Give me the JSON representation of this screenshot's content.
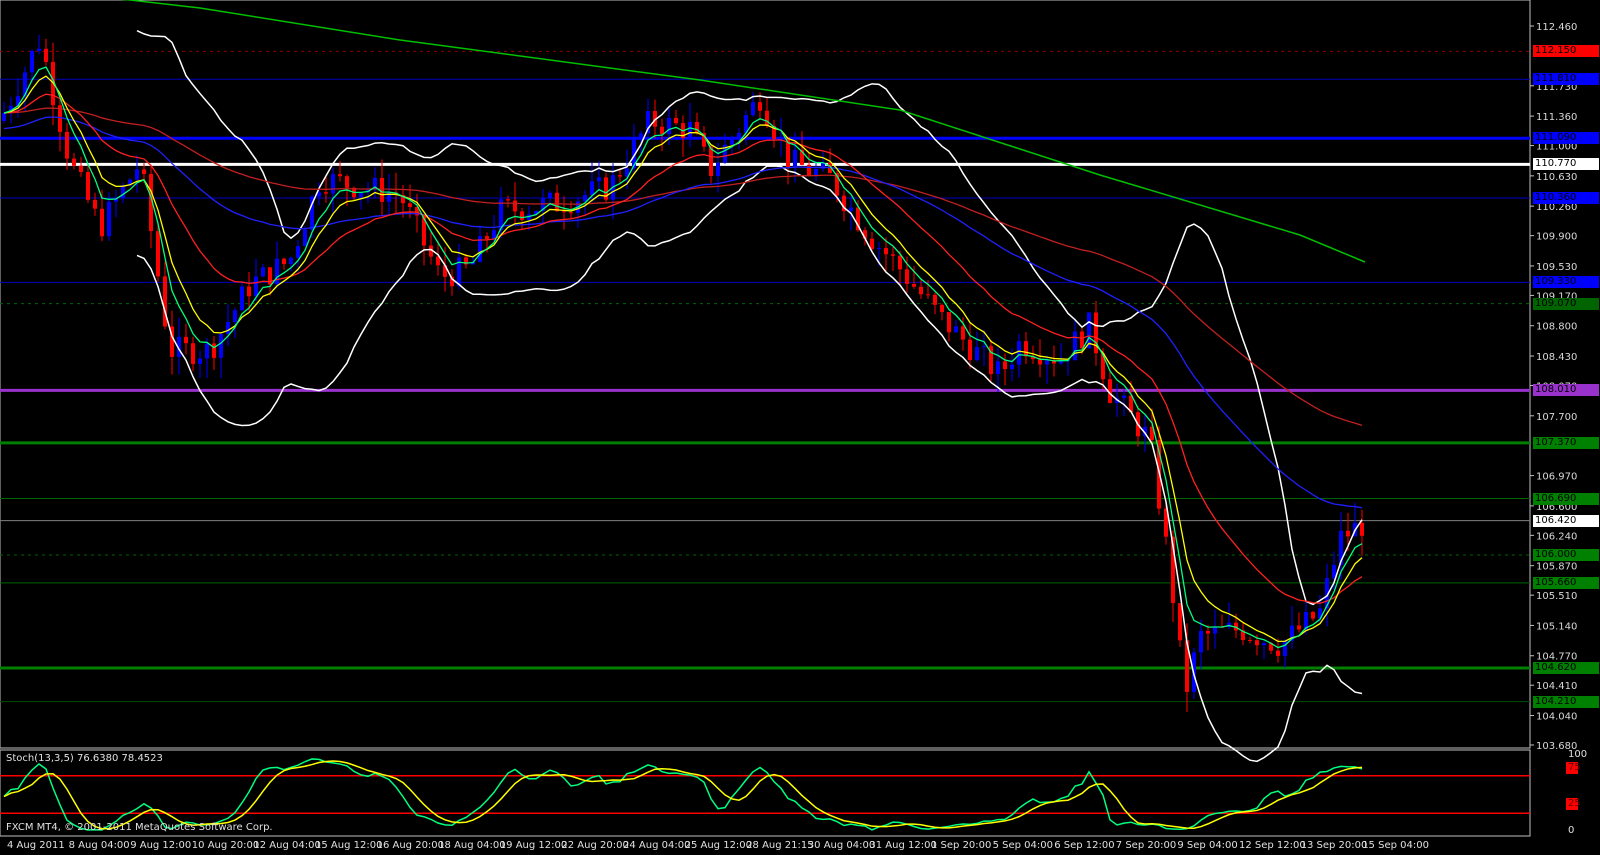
{
  "chart": {
    "symbol_pair": "USDJPY-like",
    "price_ticks": [
      "112.460",
      "111.730",
      "111.360",
      "111.000",
      "110.630",
      "110.260",
      "109.900",
      "109.530",
      "109.170",
      "108.800",
      "108.430",
      "108.070",
      "107.700",
      "106.970",
      "106.600",
      "106.240",
      "105.870",
      "105.510",
      "105.140",
      "104.770",
      "104.410",
      "104.040",
      "103.680"
    ],
    "price_range": [
      103.68,
      112.46
    ],
    "levels": [
      {
        "price": 112.15,
        "label": "112.150",
        "color": "#ff0000",
        "line": "#8b0000",
        "style": "dotted"
      },
      {
        "price": 111.81,
        "label": "111.810",
        "color": "#0000ff",
        "line": "#0000c0",
        "style": "thin"
      },
      {
        "price": 111.09,
        "label": "111.090",
        "color": "#0000ff",
        "line": "#0000ff",
        "style": "thick"
      },
      {
        "price": 110.77,
        "label": "110.770",
        "color": "#ffffff",
        "line": "#ffffff",
        "style": "thick"
      },
      {
        "price": 110.36,
        "label": "110.360",
        "color": "#0000ff",
        "line": "#0000c0",
        "style": "thin"
      },
      {
        "price": 109.33,
        "label": "109.330",
        "color": "#0000ff",
        "line": "#0000c0",
        "style": "thin"
      },
      {
        "price": 109.07,
        "label": "109.070",
        "color": "#006400",
        "line": "#006400",
        "style": "dotted"
      },
      {
        "price": 108.01,
        "label": "108.010",
        "color": "#9932cc",
        "line": "#9932cc",
        "style": "thick"
      },
      {
        "price": 107.37,
        "label": "107.370",
        "color": "#008000",
        "line": "#008000",
        "style": "thick"
      },
      {
        "price": 106.69,
        "label": "106.690",
        "color": "#008000",
        "line": "#006400",
        "style": "thin"
      },
      {
        "price": 106.42,
        "label": "106.420",
        "color": "#ffffff",
        "line": "#808080",
        "style": "thin"
      },
      {
        "price": 106.0,
        "label": "106.000",
        "color": "#008000",
        "line": "#006400",
        "style": "dotted"
      },
      {
        "price": 105.66,
        "label": "105.660",
        "color": "#008000",
        "line": "#006400",
        "style": "thin"
      },
      {
        "price": 104.62,
        "label": "104.620",
        "color": "#008000",
        "line": "#008000",
        "style": "thick"
      },
      {
        "price": 104.21,
        "label": "104.210",
        "color": "#008000",
        "line": "#004d00",
        "style": "thin"
      }
    ],
    "price_path": [
      [
        0,
        111.3
      ],
      [
        40,
        112.3
      ],
      [
        70,
        110.8
      ],
      [
        100,
        110.0
      ],
      [
        140,
        110.8
      ],
      [
        170,
        108.5
      ],
      [
        210,
        108.5
      ],
      [
        250,
        109.3
      ],
      [
        290,
        109.6
      ],
      [
        320,
        110.6
      ],
      [
        360,
        110.5
      ],
      [
        400,
        110.4
      ],
      [
        440,
        109.4
      ],
      [
        470,
        109.5
      ],
      [
        500,
        110.2
      ],
      [
        560,
        110.3
      ],
      [
        610,
        110.5
      ],
      [
        650,
        111.3
      ],
      [
        690,
        111.2
      ],
      [
        710,
        110.7
      ],
      [
        760,
        111.6
      ],
      [
        790,
        110.8
      ],
      [
        830,
        110.6
      ],
      [
        870,
        109.9
      ],
      [
        900,
        109.5
      ],
      [
        940,
        108.9
      ],
      [
        1000,
        108.2
      ],
      [
        1020,
        108.6
      ],
      [
        1060,
        108.4
      ],
      [
        1090,
        108.8
      ],
      [
        1110,
        108.0
      ],
      [
        1150,
        107.4
      ],
      [
        1170,
        105.8
      ],
      [
        1185,
        104.3
      ],
      [
        1200,
        105.0
      ],
      [
        1240,
        105.1
      ],
      [
        1280,
        104.9
      ],
      [
        1320,
        105.3
      ],
      [
        1340,
        106.2
      ],
      [
        1365,
        106.4
      ]
    ],
    "time_labels": [
      "4 Aug 2011",
      "8 Aug 04:00",
      "9 Aug 12:00",
      "10 Aug 20:00",
      "12 Aug 04:00",
      "15 Aug 12:00",
      "16 Aug 20:00",
      "18 Aug 04:00",
      "19 Aug 12:00",
      "22 Aug 20:00",
      "24 Aug 04:00",
      "25 Aug 12:00",
      "28 Aug 21:15",
      "30 Aug 04:00",
      "31 Aug 12:00",
      "1 Sep 20:00",
      "5 Sep 04:00",
      "6 Sep 12:00",
      "7 Sep 20:00",
      "9 Sep 04:00",
      "12 Sep 12:00",
      "13 Sep 20:00",
      "15 Sep 04:00"
    ],
    "colors": {
      "up": "#0000ff",
      "down": "#ff0000",
      "bands": "#ffffff",
      "ma_fast": "#00ff7f",
      "ma_mid": "#ffff00",
      "ma_slow": "#ff2020",
      "ma_55": "#2020ff",
      "ma_100": "#c02020",
      "ma_200": "#00c000"
    }
  },
  "stoch": {
    "label": "Stoch(13,3,5) 76.6380 78.4523",
    "ticks": [
      "100",
      "0"
    ],
    "levels": [
      "75",
      "25"
    ]
  },
  "footer": {
    "copyright": "FXCM MT4, © 2001-2011 MetaQuotes Software Corp."
  }
}
